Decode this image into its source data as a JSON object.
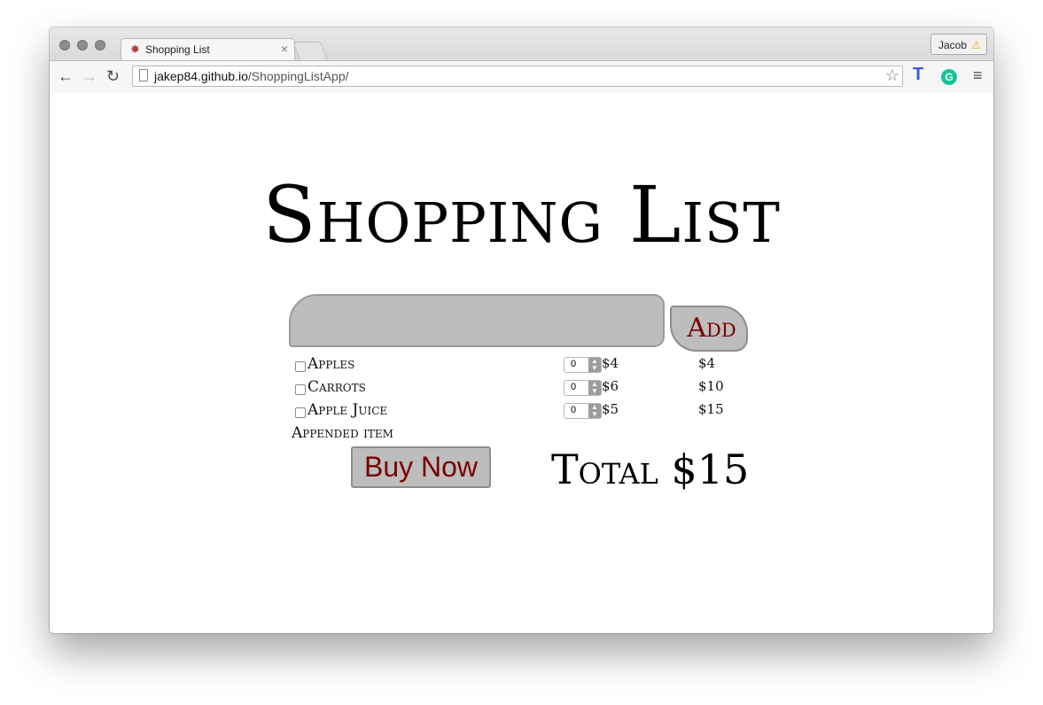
{
  "browser": {
    "tab_title": "Shopping List",
    "tab_close": "×",
    "profile_name": "Jacob",
    "url_host": "jakep84.github.io",
    "url_path": "/ShoppingListApp/",
    "icons": {
      "back": "back-arrow-icon",
      "forward": "forward-arrow-icon",
      "reload": "reload-icon",
      "star": "star-icon",
      "menu": "hamburger-menu-icon",
      "extension_t": "T-extension-icon",
      "extension_g": "grammarly-icon",
      "warning": "warning-icon"
    }
  },
  "page": {
    "title": "Shopping List",
    "add_label": "Add",
    "items": [
      {
        "name": "Apples",
        "qty": "0",
        "price": "$4",
        "subtotal": "$4"
      },
      {
        "name": "Carrots",
        "qty": "0",
        "price": "$6",
        "subtotal": "$10"
      },
      {
        "name": "Apple Juice",
        "qty": "0",
        "price": "$5",
        "subtotal": "$15"
      }
    ],
    "appended_item": "Appended item",
    "buy_label": "Buy Now",
    "total_label": "Total $15"
  },
  "colors": {
    "button_text": "#7a0000",
    "button_bg": "#bdbdbd"
  }
}
